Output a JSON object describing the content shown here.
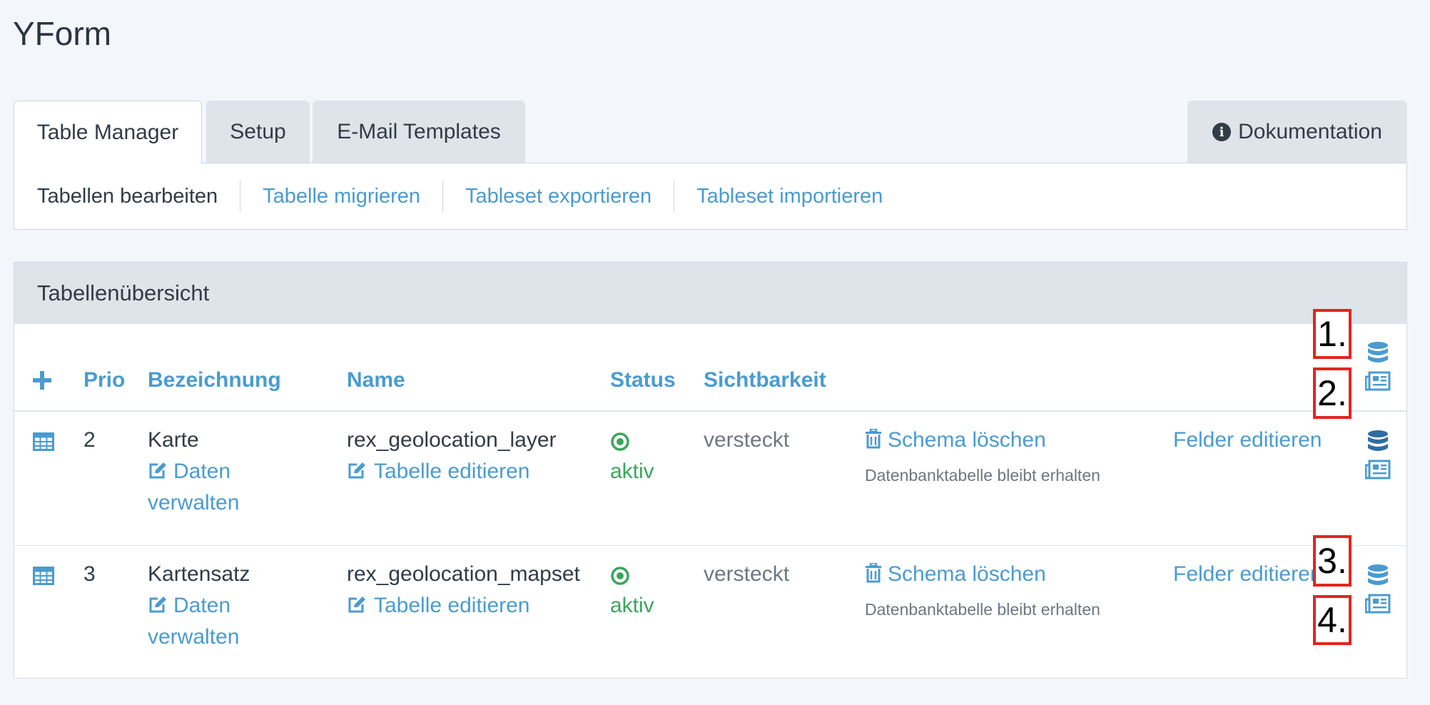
{
  "page": {
    "title": "YForm"
  },
  "tabs": [
    {
      "label": "Table Manager",
      "active": true
    },
    {
      "label": "Setup",
      "active": false
    },
    {
      "label": "E-Mail Templates",
      "active": false
    }
  ],
  "doc_tab": {
    "label": "Dokumentation",
    "icon": "info-circle-icon"
  },
  "subnav": [
    {
      "label": "Tabellen bearbeiten",
      "current": true
    },
    {
      "label": "Tabelle migrieren",
      "current": false
    },
    {
      "label": "Tableset exportieren",
      "current": false
    },
    {
      "label": "Tableset importieren",
      "current": false
    }
  ],
  "panel": {
    "title": "Tabellenübersicht"
  },
  "table": {
    "headers": {
      "prio": "Prio",
      "bezeichnung": "Bezeichnung",
      "name": "Name",
      "status": "Status",
      "sichtbarkeit": "Sichtbarkeit"
    },
    "rows": [
      {
        "prio": "2",
        "bezeichnung": "Karte",
        "daten_link_1": "Daten",
        "daten_link_2": "verwalten",
        "name": "rex_geolocation_layer",
        "edit_link": "Tabelle editieren",
        "status": "aktiv",
        "sichtbarkeit": "versteckt",
        "delete_link": "Schema löschen",
        "delete_note": "Datenbanktabelle bleibt erhalten",
        "fields_link": "Felder editieren"
      },
      {
        "prio": "3",
        "bezeichnung": "Kartensatz",
        "daten_link_1": "Daten",
        "daten_link_2": "verwalten",
        "name": "rex_geolocation_mapset",
        "edit_link": "Tabelle editieren",
        "status": "aktiv",
        "sichtbarkeit": "versteckt",
        "delete_link": "Schema löschen",
        "delete_note": "Datenbanktabelle bleibt erhalten",
        "fields_link": "Felder editieren"
      }
    ]
  },
  "annotations": [
    "1.",
    "2.",
    "3.",
    "4."
  ],
  "colors": {
    "link": "#4a9bd0",
    "active_status": "#3aa65c",
    "annotation_border": "#e0261f",
    "db_icon_dark": "#2f6da3"
  }
}
